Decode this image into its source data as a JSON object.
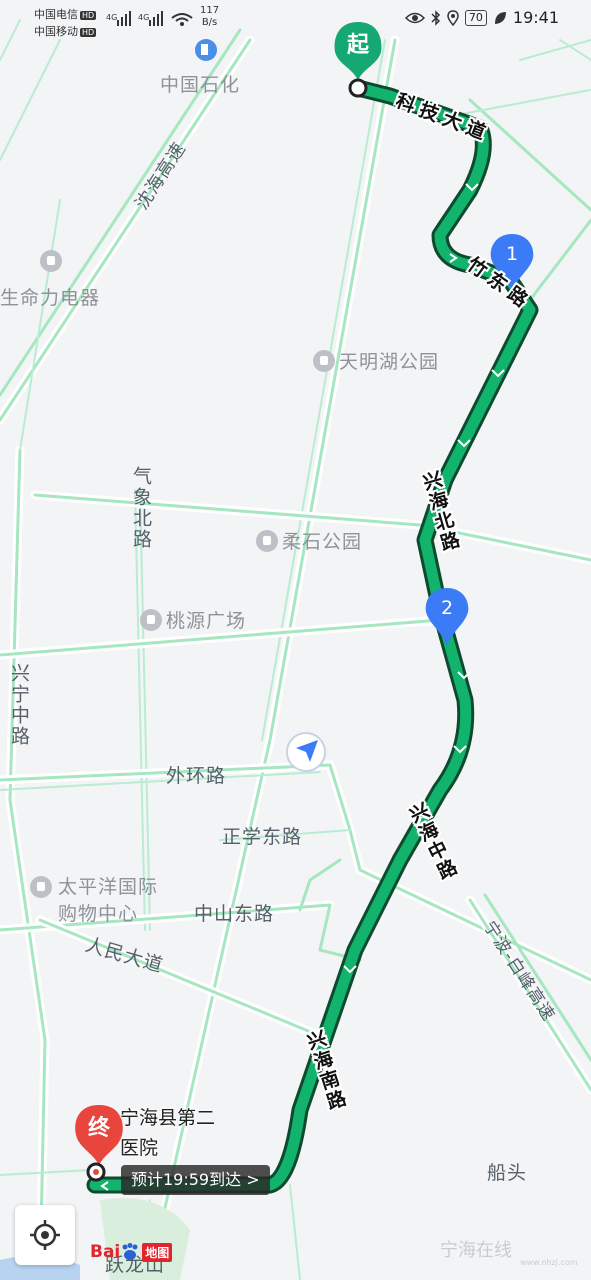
{
  "status_bar": {
    "carrier1": "中国电信",
    "carrier2": "中国移动",
    "hd": "HD",
    "net_speed_value": "117",
    "net_speed_unit": "B/s",
    "battery": "70",
    "time": "19:41"
  },
  "map": {
    "poi_gas_station": "中国石化",
    "poi_shop": "生命力电器",
    "poi_park1": "天明湖公园",
    "poi_park2": "柔石公园",
    "poi_square": "桃源广场",
    "poi_mall_line1": "太平洋国际",
    "poi_mall_line2": "购物中心",
    "road_shenhai": "沈海高速",
    "road_keji": "科技大道",
    "road_zhudong": "竹东路",
    "road_xinghai_north": "兴海北路",
    "road_xinghai_middle": "兴海中路",
    "road_xinghai_south": "兴海南路",
    "road_qixiang": "气象北路",
    "road_xingning": "兴宁中路",
    "road_waihuan": "外环路",
    "road_zhengxue": "正学东路",
    "road_zhongshan": "中山东路",
    "road_renmin": "人民大道",
    "road_ningbo": "宁波-白峰高速",
    "place_chuantou": "船头",
    "place_yuelongshan": "跃龙山"
  },
  "markers": {
    "start": "起",
    "end": "终",
    "waypoint1": "1",
    "waypoint2": "2"
  },
  "destination": {
    "name_line1": "宁海县第二",
    "name_line2": "医院",
    "eta": "预计19:59到达 >"
  },
  "branding": {
    "logo_text": "Bai",
    "logo_suffix": "地图",
    "watermark": "宁海在线",
    "watermark_url": "www.nhzj.com"
  }
}
